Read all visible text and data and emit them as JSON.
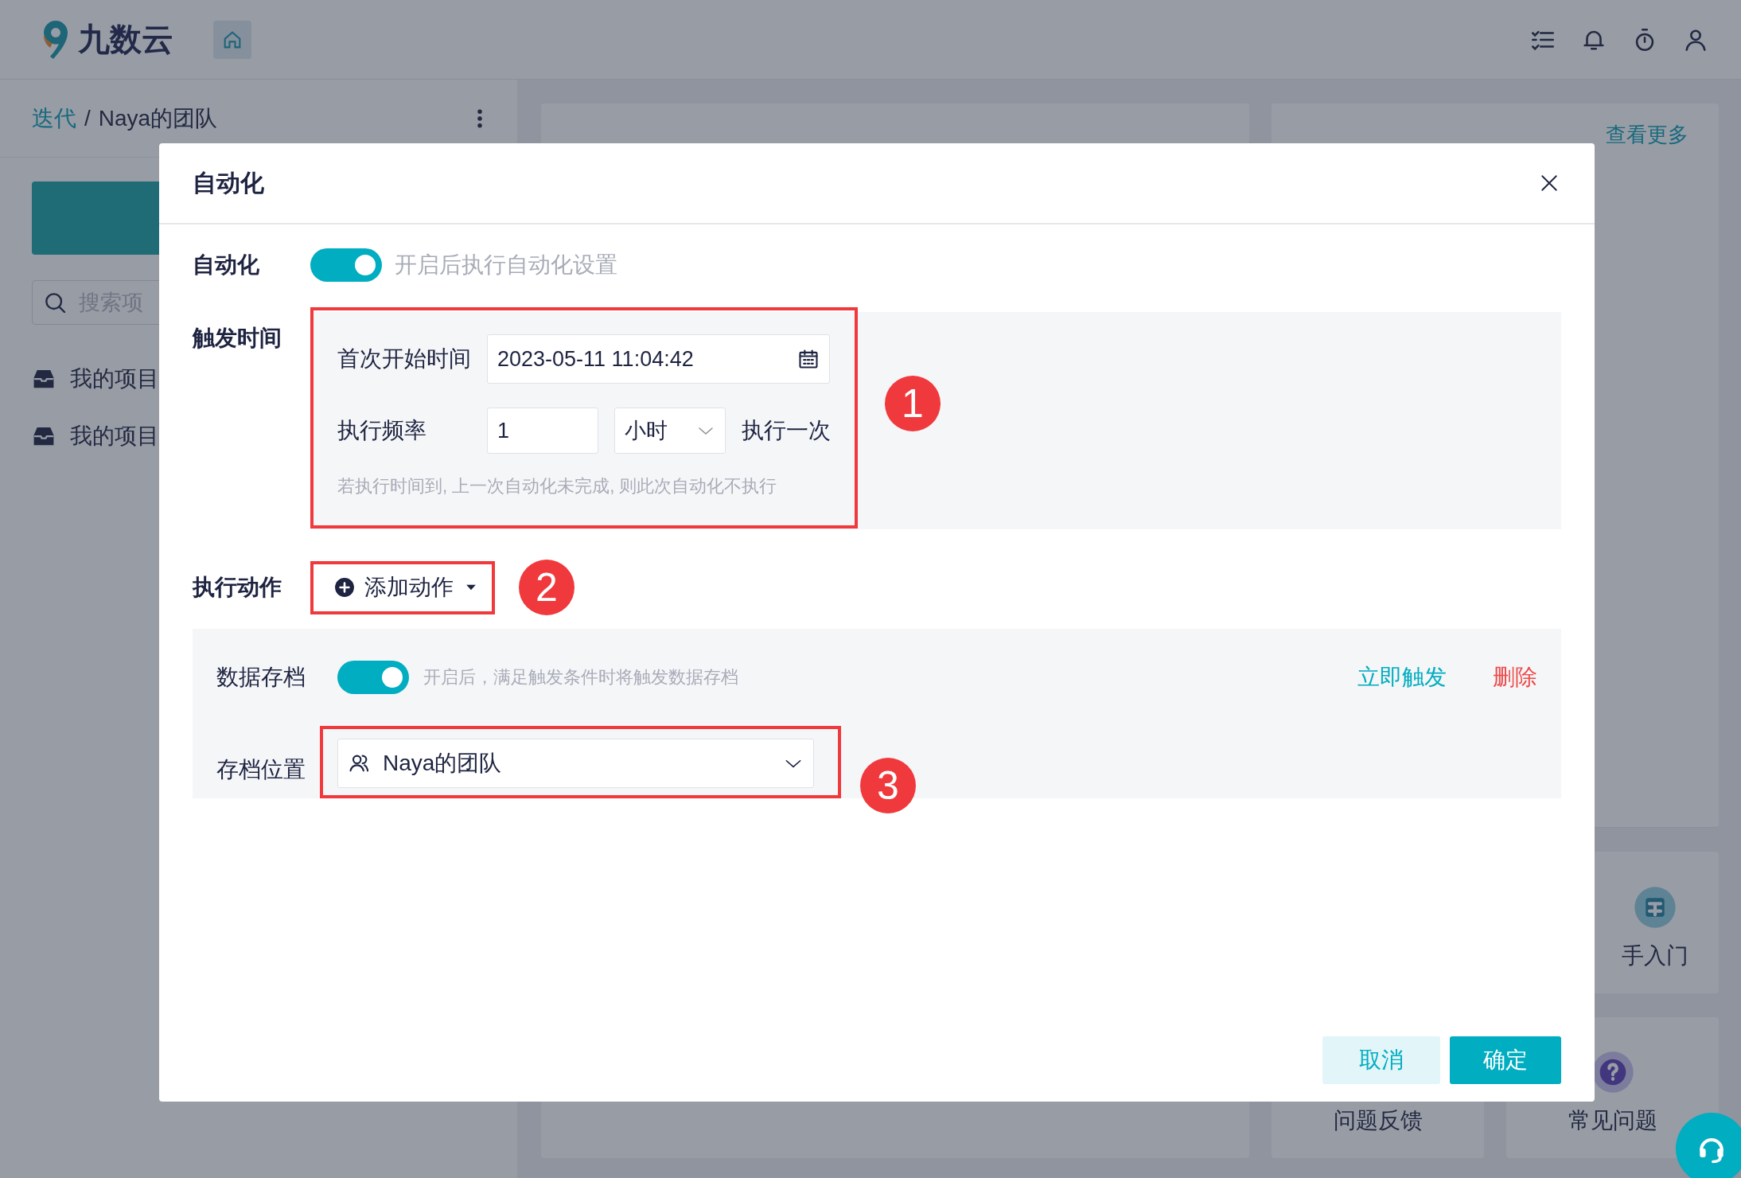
{
  "app": {
    "logo_text": "九数云"
  },
  "breadcrumb": {
    "parent": "迭代",
    "separator": "/",
    "current": "Naya的团队"
  },
  "sidebar": {
    "search": {
      "placeholder": "搜索项"
    },
    "items": [
      {
        "label": "我的项目"
      },
      {
        "label": "我的项目"
      }
    ]
  },
  "template_center": {
    "more": "查看更多"
  },
  "help_cards": [
    {
      "label": "手入门",
      "kind": "guide"
    },
    {
      "label": "问题反馈",
      "kind": "feedback"
    },
    {
      "label": "常见问题",
      "kind": "faq"
    }
  ],
  "dialog": {
    "title": "自动化",
    "automation": {
      "label": "自动化",
      "on": true,
      "hint": "开启后执行自动化设置"
    },
    "trigger": {
      "label": "触发时间",
      "start_label": "首次开始时间",
      "start_value": "2023-05-11 11:04:42",
      "freq_label": "执行频率",
      "freq_value": "1",
      "unit": "小时",
      "suffix": "执行一次",
      "note": "若执行时间到, 上一次自动化未完成, 则此次自动化不执行"
    },
    "actions": {
      "label": "执行动作",
      "add_button": "添加动作",
      "items": [
        {
          "name": "数据存档",
          "on": true,
          "hint": "开启后，满足触发条件时将触发数据存档",
          "trigger_link": "立即触发",
          "delete_link": "删除",
          "location_label": "存档位置",
          "location": "Naya的团队"
        }
      ]
    },
    "buttons": [
      {
        "label": "取消",
        "kind": "secondary"
      },
      {
        "label": "确定",
        "kind": "primary"
      }
    ]
  },
  "annotations": [
    {
      "label": "1"
    },
    {
      "label": "2"
    },
    {
      "label": "3"
    }
  ]
}
